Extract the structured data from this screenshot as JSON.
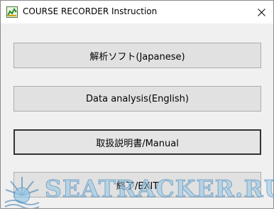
{
  "window": {
    "title": "COURSE RECORDER Instruction",
    "app_icon": "course-recorder-icon",
    "close_icon": "close-icon"
  },
  "buttons": {
    "analysis_jp": "解析ソフト(Japanese)",
    "analysis_en": "Data analysis(English)",
    "manual": "取扱説明書/Manual",
    "exit": "終了/EXIT"
  },
  "watermark": {
    "text": "SEATRACKER.RU",
    "color": "#96c8e6"
  }
}
